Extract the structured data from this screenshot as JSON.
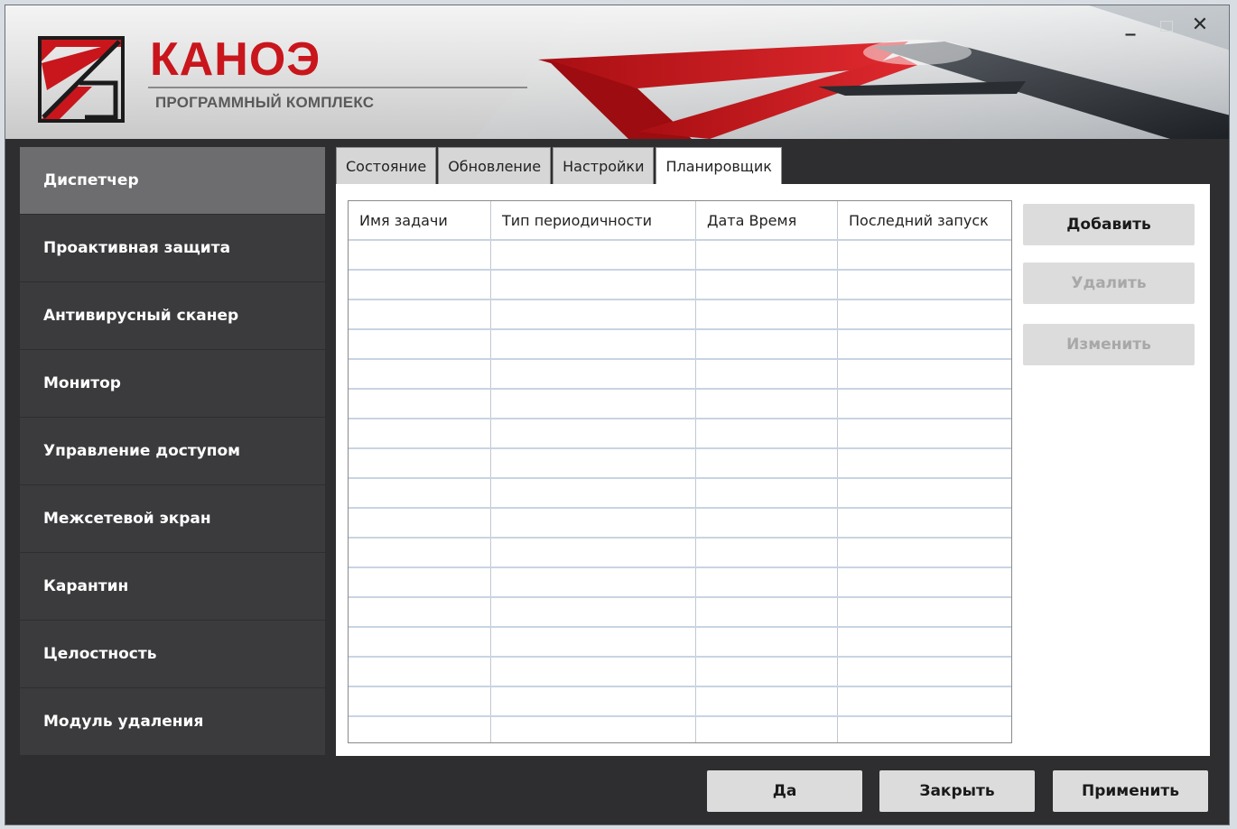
{
  "brand": {
    "title": "КАНОЭ",
    "subtitle": "ПРОГРАММНЫЙ КОМПЛЕКС",
    "accent_color": "#c8161c"
  },
  "window_controls": {
    "minimize_icon": "minimize-icon",
    "maximize_icon": "maximize-icon",
    "close_icon": "close-icon",
    "minimize": "_",
    "close": "✕"
  },
  "sidebar": {
    "items": [
      {
        "label": "Диспетчер",
        "active": true
      },
      {
        "label": "Проактивная защита",
        "active": false
      },
      {
        "label": "Антивирусный сканер",
        "active": false
      },
      {
        "label": "Монитор",
        "active": false
      },
      {
        "label": "Управление доступом",
        "active": false
      },
      {
        "label": "Межсетевой экран",
        "active": false
      },
      {
        "label": "Карантин",
        "active": false
      },
      {
        "label": "Целостность",
        "active": false
      },
      {
        "label": "Модуль удаления",
        "active": false
      }
    ]
  },
  "tabs": [
    {
      "label": "Состояние",
      "active": false
    },
    {
      "label": "Обновление",
      "active": false
    },
    {
      "label": "Настройки",
      "active": false
    },
    {
      "label": "Планировщик",
      "active": true
    }
  ],
  "table": {
    "columns": [
      "Имя задачи",
      "Тип периодичности",
      "Дата Время",
      "Последний запуск"
    ],
    "rows": []
  },
  "actions": {
    "add": "Добавить",
    "delete": "Удалить",
    "edit": "Изменить"
  },
  "footer": {
    "yes": "Да",
    "close": "Закрыть",
    "apply": "Применить"
  }
}
